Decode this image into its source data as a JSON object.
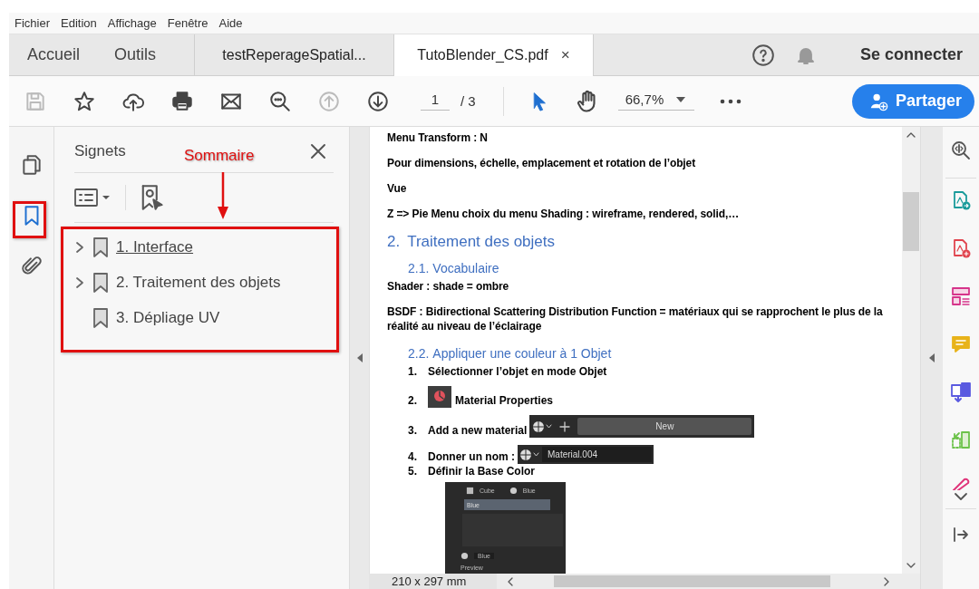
{
  "menu": [
    "Fichier",
    "Edition",
    "Affichage",
    "Fenêtre",
    "Aide"
  ],
  "tabs": [
    {
      "label": "Accueil",
      "kind": "nav",
      "selected": false
    },
    {
      "label": "Outils",
      "kind": "nav",
      "selected": false
    },
    {
      "label": "testReperageSpatial...",
      "kind": "doc",
      "selected": false
    },
    {
      "label": "TutoBlender_CS.pdf",
      "kind": "doc",
      "selected": true,
      "close": "×"
    }
  ],
  "account": {
    "sign_in": "Se connecter"
  },
  "toolbar": {
    "buttons": [
      {
        "kind": "save",
        "disabled": true
      },
      {
        "kind": "star",
        "disabled": false
      },
      {
        "kind": "upload",
        "disabled": false
      },
      {
        "kind": "print",
        "disabled": false
      },
      {
        "kind": "mail",
        "disabled": false
      },
      {
        "kind": "zoom",
        "disabled": false
      },
      {
        "kind": "prev",
        "disabled": true
      },
      {
        "kind": "next",
        "disabled": false
      }
    ],
    "page_current": "1",
    "page_total": "/ 3",
    "zoom": "66,7%",
    "share": "Partager"
  },
  "left_rail": [
    {
      "kind": "pages",
      "selected": false
    },
    {
      "kind": "bookmarks",
      "selected": true
    },
    {
      "kind": "attachments",
      "selected": false
    }
  ],
  "bookmarks_panel": {
    "title": "Signets",
    "items": [
      {
        "label": "1. Interface",
        "expandable": true,
        "selected": true
      },
      {
        "label": "2. Traitement des objets",
        "expandable": true,
        "selected": false
      },
      {
        "label": "3. Dépliage UV",
        "expandable": false,
        "selected": false
      }
    ]
  },
  "annotation": {
    "label": "Sommaire"
  },
  "document": {
    "blocks": [
      {
        "kind": "p",
        "text": "Menu Transform : N"
      },
      {
        "kind": "p",
        "text": "Pour dimensions, échelle, emplacement et rotation de l’objet"
      },
      {
        "kind": "p",
        "text": "Vue"
      },
      {
        "kind": "p",
        "text": "Z => Pie Menu choix du menu Shading : wireframe, rendered, solid,…"
      },
      {
        "kind": "h1",
        "number": "2.",
        "text": "Traitement des objets"
      },
      {
        "kind": "h2",
        "number": "2.1.",
        "text": "Vocabulaire"
      },
      {
        "kind": "p",
        "text": "Shader : shade = ombre"
      },
      {
        "kind": "p",
        "text": "BSDF : Bidirectional Scattering Distribution Function = matériaux qui se rapprochent le plus de la réalité au niveau de l’éclairage"
      },
      {
        "kind": "h2",
        "number": "2.2.",
        "text": "Appliquer une couleur à 1 Objet"
      },
      {
        "kind": "step",
        "number": "1.",
        "text": "Sélectionner l’objet en mode Objet"
      },
      {
        "kind": "step",
        "number": "2.",
        "text": "Material Properties",
        "figure": {
          "kind": "material-icon"
        }
      },
      {
        "kind": "step",
        "number": "3.",
        "text": "Add a new material",
        "figure": {
          "kind": "new-bar",
          "label": "New"
        }
      },
      {
        "kind": "step",
        "number": "4.",
        "text": "Donner un nom :",
        "figure": {
          "kind": "name-field",
          "value": "Material.004"
        }
      },
      {
        "kind": "step",
        "number": "5.",
        "text": "Définir la Base Color"
      },
      {
        "kind": "figure",
        "figure": {
          "kind": "material-panel",
          "labels": [
            "Cube",
            "Blue",
            "Blue",
            "Blue",
            "Preview"
          ]
        }
      }
    ],
    "page_size": "210 x 297 mm"
  }
}
